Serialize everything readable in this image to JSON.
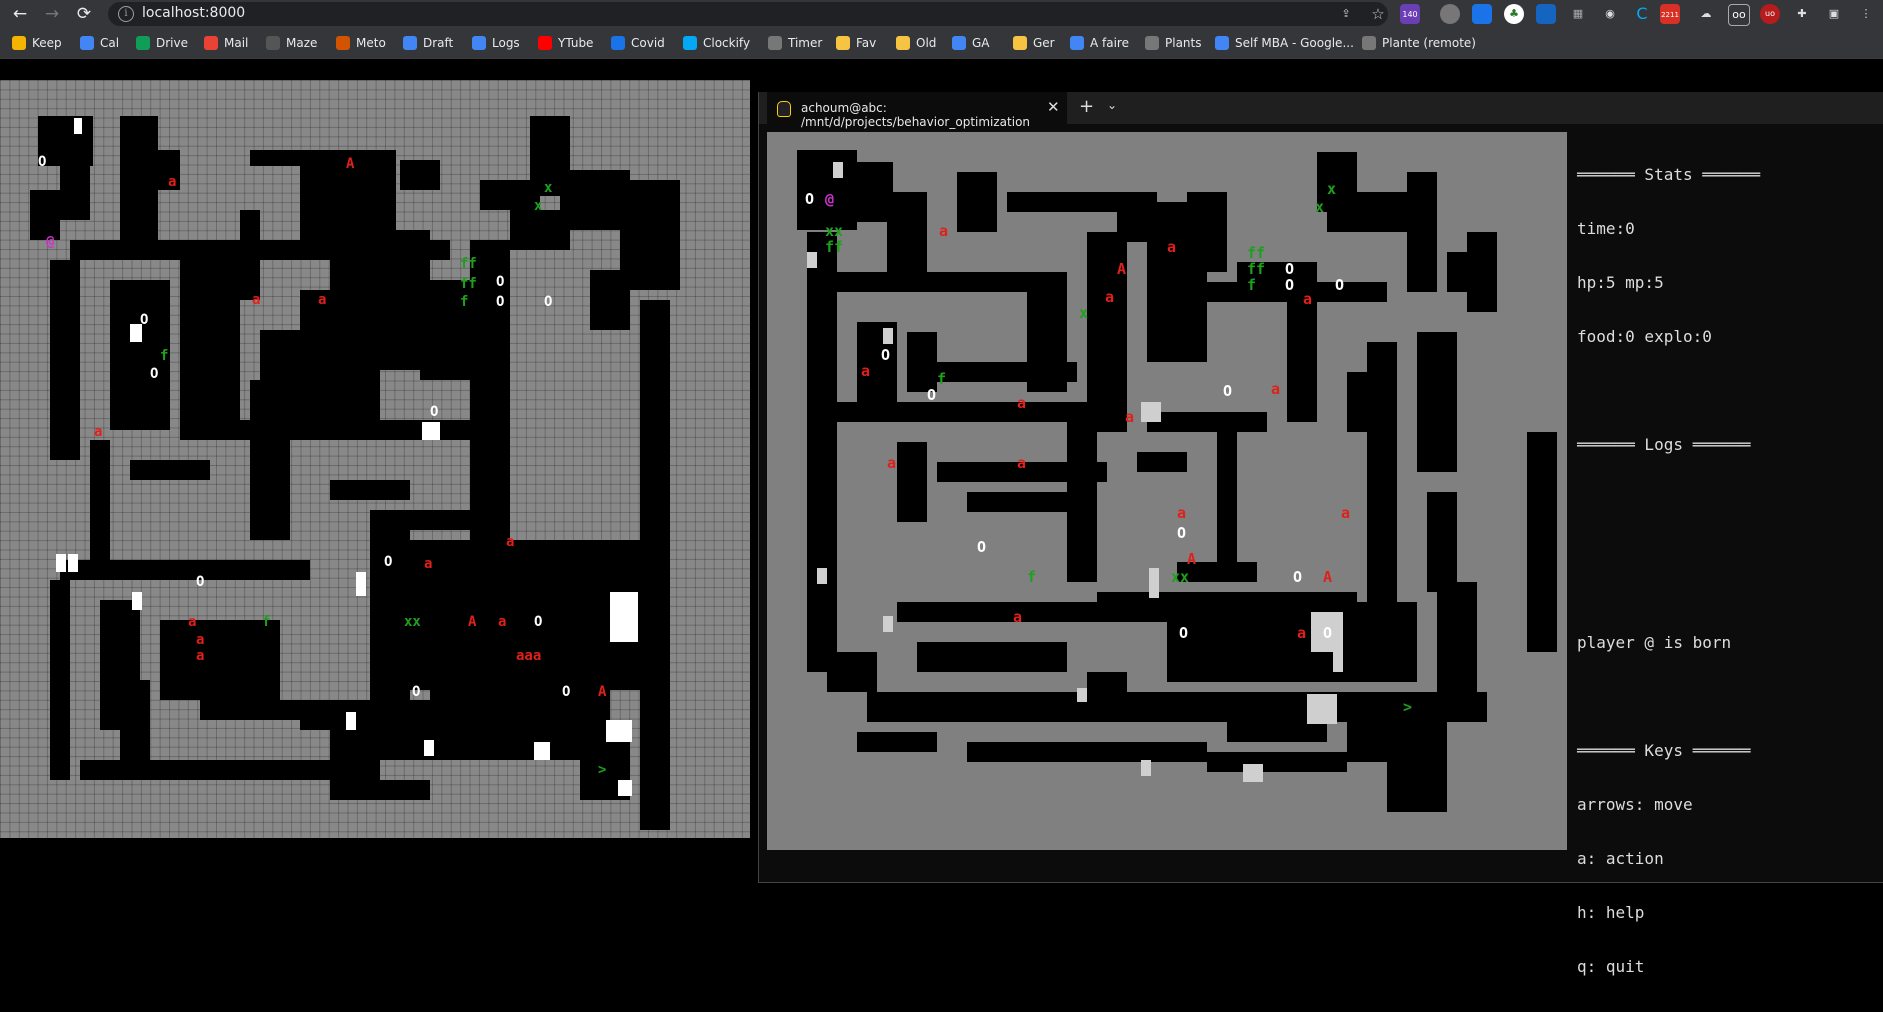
{
  "browser": {
    "url": "localhost:8000",
    "nav": {
      "back": "←",
      "forward": "→",
      "reload": "⟳"
    },
    "toolbar_badges": {
      "badge_a": "140",
      "badge_b": "2211"
    },
    "bookmarks": [
      {
        "label": "Keep",
        "icon": "keep-icon",
        "color": "#f4b400"
      },
      {
        "label": "Cal",
        "icon": "calendar-icon",
        "color": "#4285f4"
      },
      {
        "label": "Drive",
        "icon": "drive-icon",
        "color": "#0f9d58"
      },
      {
        "label": "Mail",
        "icon": "gmail-icon",
        "color": "#ea4335"
      },
      {
        "label": "Maze",
        "icon": "robot-icon",
        "color": "#555555"
      },
      {
        "label": "Meto",
        "icon": "weather-icon",
        "color": "#d35400"
      },
      {
        "label": "Draft",
        "icon": "docs-icon",
        "color": "#4285f4"
      },
      {
        "label": "Logs",
        "icon": "docs-icon",
        "color": "#4285f4"
      },
      {
        "label": "YTube",
        "icon": "youtube-icon",
        "color": "#ff0000"
      },
      {
        "label": "Covid",
        "icon": "data-icon",
        "color": "#1a73e8"
      },
      {
        "label": "Clockify",
        "icon": "clockify-icon",
        "color": "#03a9f4"
      },
      {
        "label": "Timer",
        "icon": "globe-icon",
        "color": "#777777"
      },
      {
        "label": "Fav",
        "icon": "folder-icon",
        "color": "#f6c343"
      },
      {
        "label": "Old",
        "icon": "folder-icon",
        "color": "#f6c343"
      },
      {
        "label": "GA",
        "icon": "docs-icon",
        "color": "#4285f4"
      },
      {
        "label": "Ger",
        "icon": "folder-icon",
        "color": "#f6c343"
      },
      {
        "label": "A faire",
        "icon": "docs-icon",
        "color": "#4285f4"
      },
      {
        "label": "Plants",
        "icon": "globe-icon",
        "color": "#777777"
      },
      {
        "label": "Self MBA - Google...",
        "icon": "docs-icon",
        "color": "#4285f4"
      },
      {
        "label": "Plante (remote)",
        "icon": "globe-icon",
        "color": "#777777"
      }
    ]
  },
  "terminal": {
    "tab_title": "achoum@abc: /mnt/d/projects/behavior_optimization",
    "close": "✕",
    "plus": "+",
    "chevron": "⌄",
    "stats": {
      "header": "══════ Stats ══════",
      "time": "time:0",
      "hp_mp": "hp:5 mp:5",
      "food_explo": "food:0 explo:0"
    },
    "logs": {
      "header": "══════ Logs ══════",
      "entry": "player @ is born"
    },
    "keys": {
      "header": "══════ Keys ══════",
      "move": "arrows: move",
      "action": "a: action",
      "help": "h: help",
      "quit": "q: quit"
    }
  },
  "map_glyphs": {
    "player": "@",
    "monster_small": "a",
    "monster_big": "A",
    "food": "f",
    "food_pair": "ff",
    "item": "x",
    "item_pair": "xx",
    "rock": "O",
    "exit": ">",
    "triple_a": "aaa"
  },
  "colors": {
    "floor": "#000000",
    "wall": "#888888",
    "monster": "#e0201a",
    "food": "#1ea01e",
    "player": "#cc33cc",
    "white": "#ffffff"
  }
}
